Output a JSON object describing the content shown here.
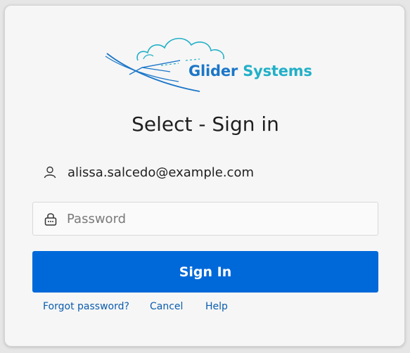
{
  "logo": {
    "brand_word1": "Glider",
    "brand_word2": "Systems"
  },
  "title": "Select - Sign in",
  "account": {
    "email": "alissa.salcedo@example.com",
    "icon": "person-icon"
  },
  "password_field": {
    "placeholder": "Password",
    "value": "",
    "icon": "lock-icon"
  },
  "signin_button": {
    "label": "Sign In"
  },
  "links": {
    "forgot": "Forgot password?",
    "cancel": "Cancel",
    "help": "Help"
  },
  "colors": {
    "primary": "#0069d9",
    "link": "#0b5cad",
    "brand_blue": "#1b76c8",
    "brand_teal": "#22b0c7",
    "background": "#f6f6f6"
  }
}
